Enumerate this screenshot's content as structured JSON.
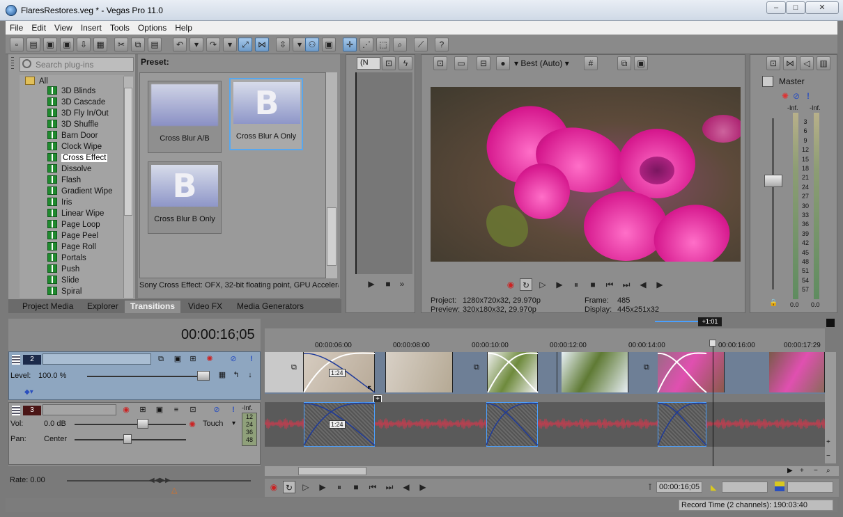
{
  "window": {
    "title": "FlaresRestores.veg * - Vegas Pro 11.0",
    "min": "–",
    "max": "□",
    "close": "✕"
  },
  "menu": [
    "File",
    "Edit",
    "View",
    "Insert",
    "Tools",
    "Options",
    "Help"
  ],
  "plugin_panel": {
    "search_placeholder": "Search plug-ins",
    "root": "All",
    "items": [
      "3D Blinds",
      "3D Cascade",
      "3D Fly In/Out",
      "3D Shuffle",
      "Barn Door",
      "Clock Wipe",
      "Cross Effect",
      "Dissolve",
      "Flash",
      "Gradient Wipe",
      "Iris",
      "Linear Wipe",
      "Page Loop",
      "Page Peel",
      "Page Roll",
      "Portals",
      "Push",
      "Slide",
      "Spiral"
    ],
    "selected": "Cross Effect",
    "preset_label": "Preset:",
    "presets": [
      {
        "label": "Cross Blur A/B",
        "glyph": ""
      },
      {
        "label": "Cross Blur A Only",
        "glyph": "B"
      },
      {
        "label": "Cross Blur B Only",
        "glyph": "B"
      }
    ],
    "description": "Sony Cross Effect: OFX, 32-bit floating point, GPU Accelera"
  },
  "tabs": [
    "Project Media",
    "Explorer",
    "Transitions",
    "Video FX",
    "Media Generators"
  ],
  "active_tab": "Transitions",
  "trimmer": {
    "dropdown": "(N"
  },
  "preview": {
    "quality": "Best (Auto)",
    "project_label": "Project:",
    "project_value": "1280x720x32, 29.970p",
    "preview_label": "Preview:",
    "preview_value": "320x180x32, 29.970p",
    "frame_label": "Frame:",
    "frame_value": "485",
    "display_label": "Display:",
    "display_value": "445x251x32"
  },
  "mixer": {
    "label": "Master",
    "left_peak": "-Inf.",
    "right_peak": "-Inf.",
    "scale": [
      "3",
      "6",
      "9",
      "12",
      "15",
      "18",
      "21",
      "24",
      "27",
      "30",
      "33",
      "36",
      "39",
      "42",
      "45",
      "48",
      "51",
      "54",
      "57"
    ],
    "left_val": "0.0",
    "right_val": "0.0"
  },
  "timeline": {
    "timecode": "00:00:16;05",
    "ruler": [
      "00:00:06:00",
      "00:00:08:00",
      "00:00:10:00",
      "00:00:12:00",
      "00:00:14:00",
      "00:00:16:00",
      "00:00:17:29"
    ],
    "marker": "+1:01",
    "clip_label_1": "1:24",
    "clip_label_2": "1:24",
    "video_track": {
      "number": "2",
      "level_label": "Level:",
      "level_value": "100.0 %"
    },
    "audio_track": {
      "number": "3",
      "vol_label": "Vol:",
      "vol_value": "0.0 dB",
      "pan_label": "Pan:",
      "pan_value": "Center",
      "mode": "Touch",
      "meter_top": "-Inf.",
      "meter_scale": [
        "12",
        "24",
        "36",
        "48"
      ]
    },
    "rate": "Rate: 0.00",
    "transport_time": "00:00:16;05",
    "record_time": "Record Time (2 channels): 190:03:40"
  }
}
